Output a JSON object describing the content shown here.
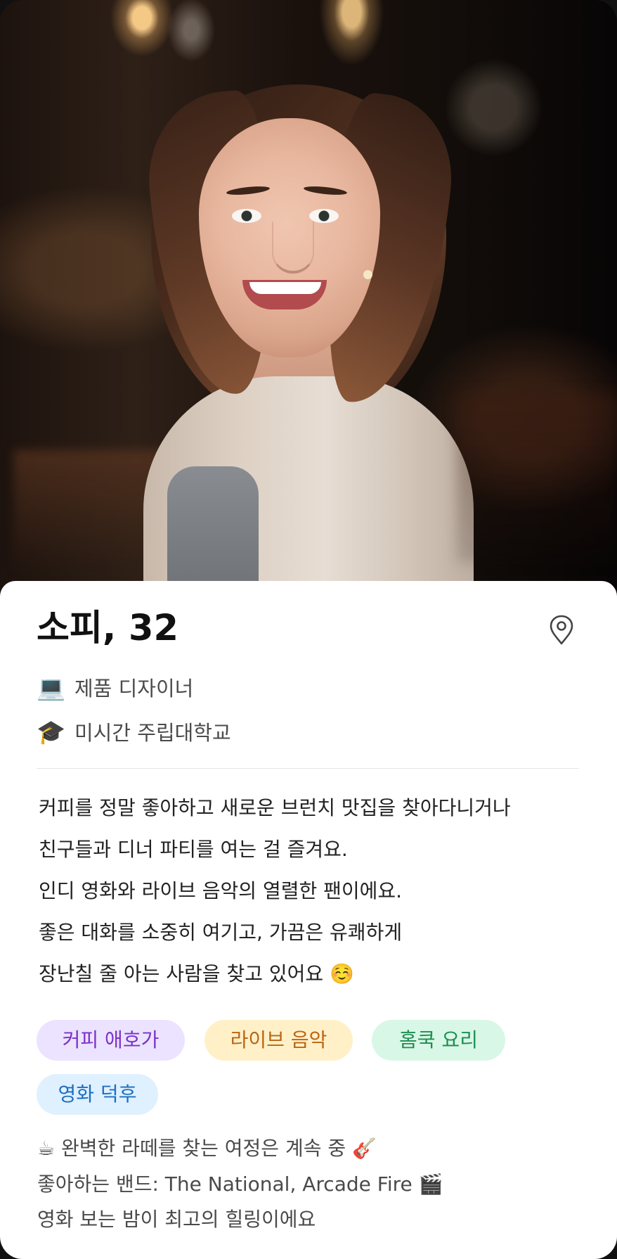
{
  "profile": {
    "name_age": "소피, 32",
    "job": "제품 디자이너",
    "school": "미시간 주립대학교",
    "job_icon": "💻",
    "school_icon": "🎓",
    "location_icon": "location-pin-icon",
    "bio_lines": [
      "커피를 정말 좋아하고 새로운 브런치 맛집을 찾아다니거나",
      "친구들과 디너 파티를 여는 걸 즐겨요.",
      "인디 영화와 라이브 음악의 열렬한 팬이에요.",
      "좋은 대화를 소중히 여기고, 가끔은 유쾌하게",
      "장난칠 줄 아는 사람을 찾고 있어요 ☺️"
    ],
    "tags": [
      {
        "label": "커피 애호가",
        "bg": "#ebe3ff",
        "fg": "#7b32c7"
      },
      {
        "label": "라이브 음악",
        "bg": "#fff0c8",
        "fg": "#b86614"
      },
      {
        "label": "홈쿡 요리",
        "bg": "#d9f7e6",
        "fg": "#1d8f52"
      },
      {
        "label": "영화 덕후",
        "bg": "#dff0ff",
        "fg": "#1b6fc1"
      }
    ],
    "notes": [
      "☕ 완벽한 라떼를 찾는 여정은 계속 중 🎸",
      "좋아하는 밴드: The National, Arcade Fire 🎬",
      "영화 보는 밤이 최고의 힐링이에요"
    ]
  },
  "colors": {
    "sheet_bg": "#ffffff",
    "primary_text": "#111111",
    "secondary_text": "#4b4b4b",
    "divider": "#e5e5e5"
  }
}
